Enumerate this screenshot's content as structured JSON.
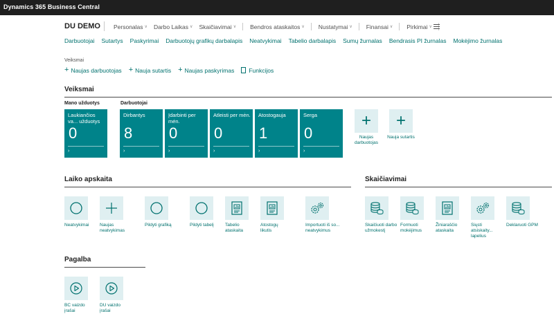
{
  "app": {
    "title": "Dynamics 365 Business Central"
  },
  "header": {
    "company": "DU DEMO",
    "menu": [
      "Personalas",
      "Darbo Laikas",
      "Skaičiavimai",
      "Bendros ataskaitos",
      "Nustatymai",
      "Finansai",
      "Pirkimai"
    ]
  },
  "nav_links": [
    "Darbuotojai",
    "Sutartys",
    "Paskyrimai",
    "Darbuotojų grafikų darbalapis",
    "Neatvykimai",
    "Tabelio darbalapis",
    "Sumų žurnalas",
    "Bendrasis PI žurnalas",
    "Mokėjimo žurnalas"
  ],
  "actions": {
    "title": "Veiksmai",
    "items": [
      {
        "label": "Naujas darbuotojas",
        "icon": "plus-icon"
      },
      {
        "label": "Nauja sutartis",
        "icon": "plus-icon"
      },
      {
        "label": "Naujas paskyrimas",
        "icon": "plus-icon"
      },
      {
        "label": "Funkcijos",
        "icon": "document-icon"
      }
    ]
  },
  "veiksmai_section": {
    "title": "Veiksmai",
    "group1_label": "Mano užduotys",
    "group2_label": "Darbuotojai",
    "tiles": [
      {
        "label": "Laukiančios va... užduotys",
        "value": "0"
      },
      {
        "label": "Dirbantys",
        "value": "8"
      },
      {
        "label": "Įdarbinti per mėn.",
        "value": "0"
      },
      {
        "label": "Atleisti per mėn.",
        "value": "0"
      },
      {
        "label": "Atostogauja",
        "value": "1"
      },
      {
        "label": "Serga",
        "value": "0"
      }
    ],
    "add_tiles": [
      {
        "label": "Naujas darbuotojas",
        "icon": "plus-icon"
      },
      {
        "label": "Nauja sutartis",
        "icon": "plus-icon"
      }
    ]
  },
  "laiko_apskaita": {
    "title": "Laiko apskaita",
    "items": [
      {
        "label": "Neatvykimai",
        "icon": "circle-icon"
      },
      {
        "label": "Naujas neatvykimas",
        "icon": "plus-icon"
      },
      {
        "label": "Pildyti grafiką",
        "icon": "circle-icon"
      },
      {
        "label": "Pildyti tabelį",
        "icon": "circle-icon"
      },
      {
        "label": "Tabelio ataskaita",
        "icon": "report-icon"
      },
      {
        "label": "Atostogų likutis",
        "icon": "report-icon"
      },
      {
        "label": "Importuoti iš so... neatvykimus",
        "icon": "gears-icon"
      }
    ]
  },
  "skaiciavimai": {
    "title": "Skaičiavimai",
    "items": [
      {
        "label": "Skaičiuoti darbo užmokestį",
        "icon": "coins-icon"
      },
      {
        "label": "Formuoti mokėjimus",
        "icon": "coins-icon"
      },
      {
        "label": "Žiniaraščio ataskaita",
        "icon": "report-icon"
      },
      {
        "label": "Siųsti atsiskaity... lapelius",
        "icon": "gears-icon"
      },
      {
        "label": "Deklaruoti GPM",
        "icon": "coins-icon"
      }
    ]
  },
  "pagalba": {
    "title": "Pagalba",
    "items": [
      {
        "label": "BC vaizdo įrašai",
        "icon": "play-icon"
      },
      {
        "label": "DU vaizdo įrašai",
        "icon": "play-icon"
      }
    ]
  },
  "colors": {
    "accent": "#00716e",
    "tile": "#00838a",
    "icon_bg": "#dfeff1",
    "topbar": "#1f1f1f"
  }
}
